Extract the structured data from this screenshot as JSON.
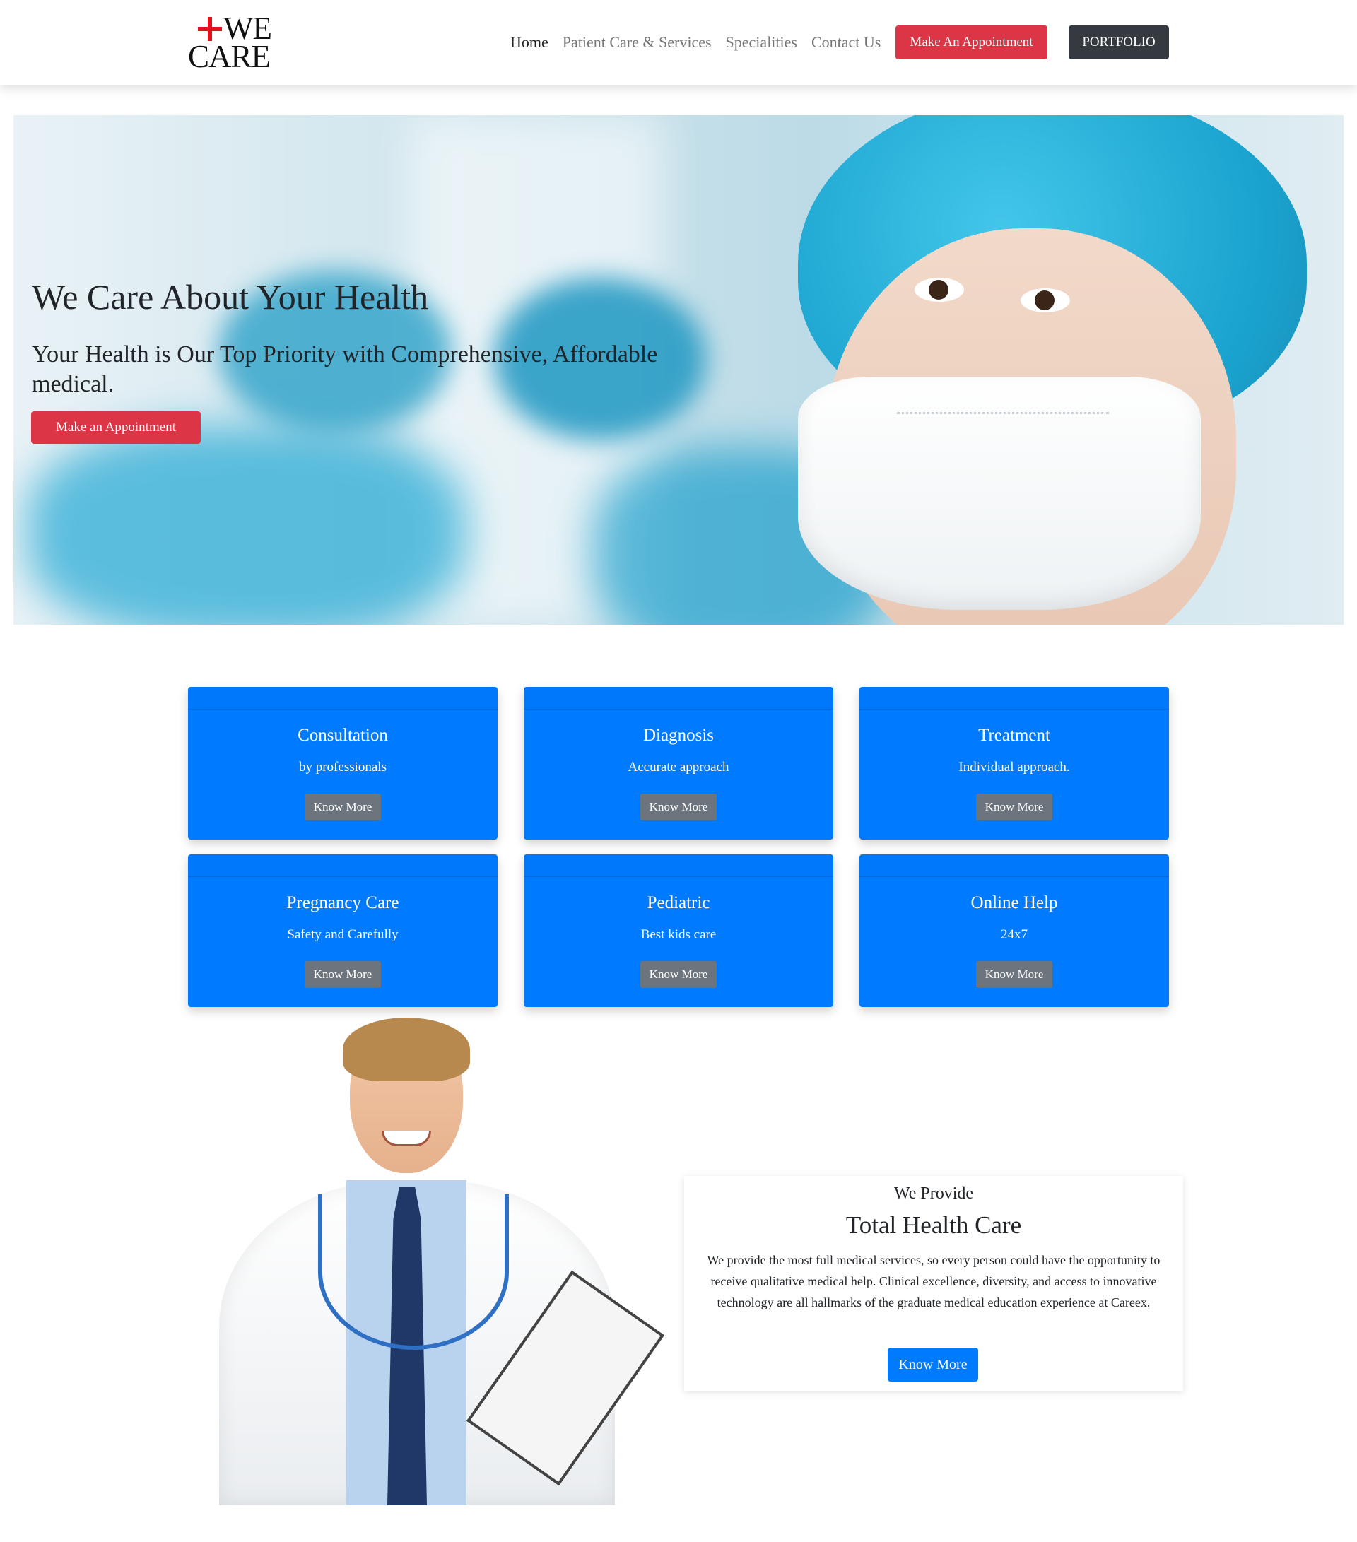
{
  "brand": {
    "line1": "WE",
    "line2": "CARE",
    "cross_color": "#e0121b"
  },
  "nav": {
    "links": [
      "Home",
      "Patient Care & Services",
      "Specialities",
      "Contact Us"
    ],
    "appointment_label": "Make An Appointment",
    "portfolio_label": "PORTFOLIO"
  },
  "hero": {
    "title": "We Care About Your Health",
    "subtitle": "Your Health is Our Top Priority with Comprehensive, Affordable medical.",
    "button_label": "Make an Appointment"
  },
  "services": [
    {
      "title": "Consultation",
      "text": "by professionals",
      "button": "Know More"
    },
    {
      "title": "Diagnosis",
      "text": "Accurate approach",
      "button": "Know More"
    },
    {
      "title": "Treatment",
      "text": "Individual approach.",
      "button": "Know More"
    },
    {
      "title": "Pregnancy Care",
      "text": "Safety and Carefully",
      "button": "Know More"
    },
    {
      "title": "Pediatric",
      "text": "Best kids care",
      "button": "Know More"
    },
    {
      "title": "Online Help",
      "text": "24x7",
      "button": "Know More"
    }
  ],
  "provide": {
    "label": "We Provide",
    "title": "Total Health Care",
    "text": "We provide the most full medical services, so every person could have the opportunity to receive qualitative medical help. Clinical excellence, diversity, and access to innovative technology are all hallmarks of the graduate medical education experience at Careex.",
    "button_label": "Know More"
  },
  "colors": {
    "primary": "#007bff",
    "danger": "#dc3545",
    "dark": "#343a40",
    "secondary": "#6c757d"
  }
}
